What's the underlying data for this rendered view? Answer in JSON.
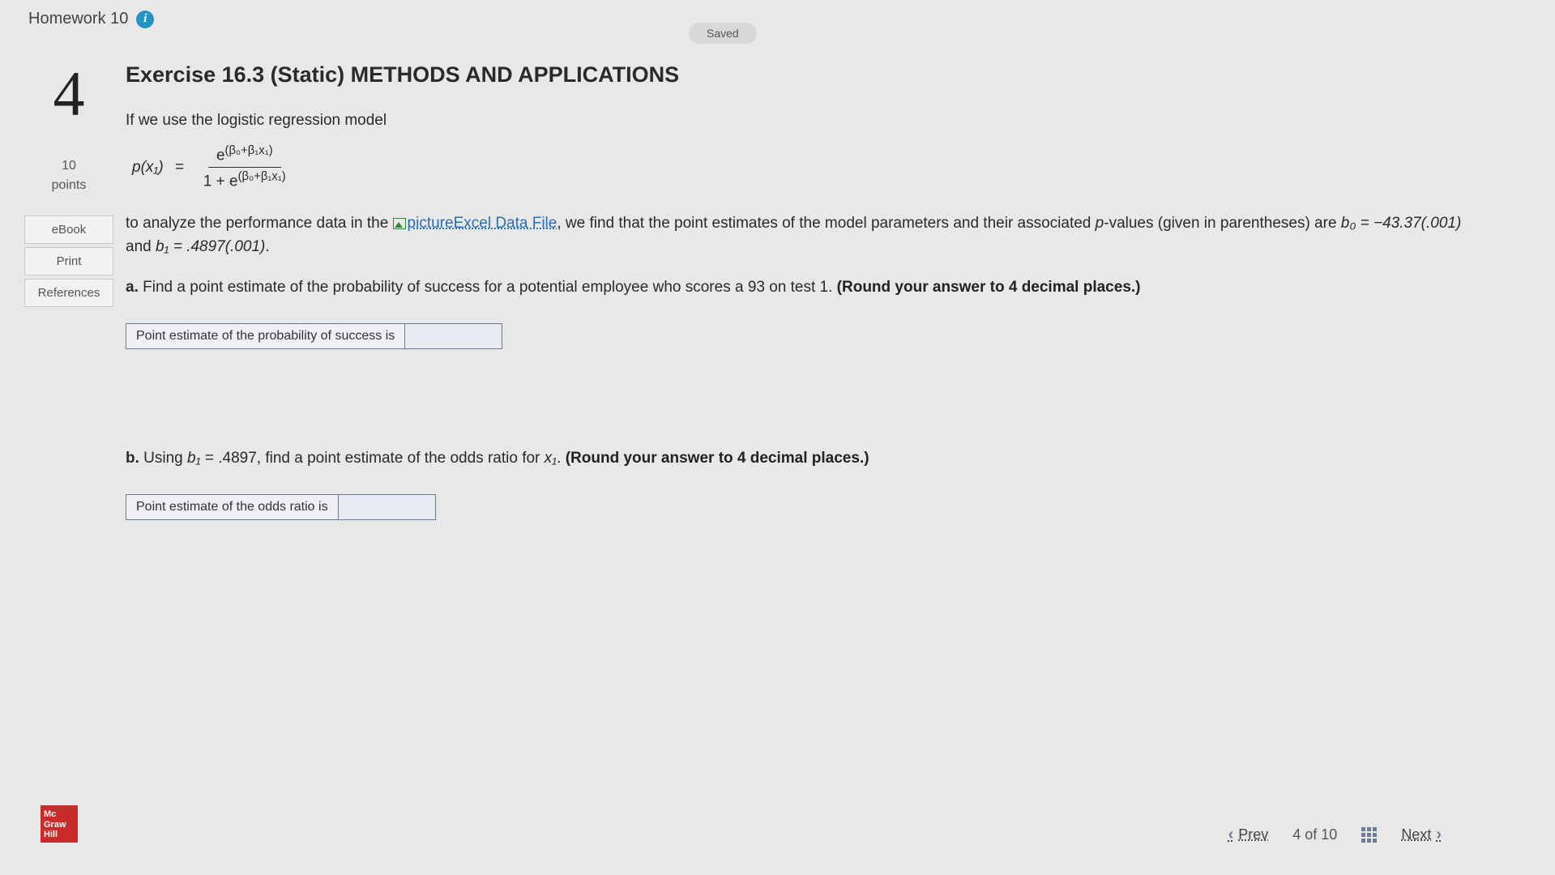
{
  "header": {
    "title": "Homework 10",
    "info_glyph": "i",
    "saved": "Saved"
  },
  "sidebar": {
    "question_number": "4",
    "points_value": "10",
    "points_label": "points",
    "buttons": {
      "ebook": "eBook",
      "print": "Print",
      "references": "References"
    }
  },
  "content": {
    "title": "Exercise 16.3 (Static) METHODS AND APPLICATIONS",
    "lead": "If we use the logistic regression model",
    "formula": {
      "lhs": "p(x₁)",
      "eq": "=",
      "num": "e",
      "num_exp": "(β₀+β₁x₁)",
      "den_prefix": "1 + e",
      "den_exp": "(β₀+β₁x₁)"
    },
    "para1_a": "to analyze the performance data in the ",
    "excel_link_text": "pictureExcel Data File",
    "para1_b": ", we find that the point estimates of the model parameters and their associated ",
    "pvalues": "p",
    "para1_c": "-values (given in parentheses) are ",
    "b0": "b₀ = −43.37(.001)",
    "para1_d": " and ",
    "b1": "b₁ = .4897(.001)",
    "para1_e": ".",
    "qa_label": "a.",
    "qa_text": " Find a point estimate of the probability of success for a potential employee who scores a 93 on test 1. ",
    "qa_bold": "(Round your answer to 4 decimal places.)",
    "ans_a_label": "Point estimate of the probability of success is",
    "qb_label": "b.",
    "qb_text_a": " Using ",
    "qb_b1": "b₁",
    "qb_text_b": " = .4897, find a point estimate of the odds ratio for ",
    "qb_x1": "x₁",
    "qb_text_c": ". ",
    "qb_bold": "(Round your answer to 4 decimal places.)",
    "ans_b_label": "Point estimate of the odds ratio is"
  },
  "footer": {
    "logo": "Mc\nGraw\nHill",
    "prev": "Prev",
    "position": "4 of 10",
    "next": "Next"
  }
}
